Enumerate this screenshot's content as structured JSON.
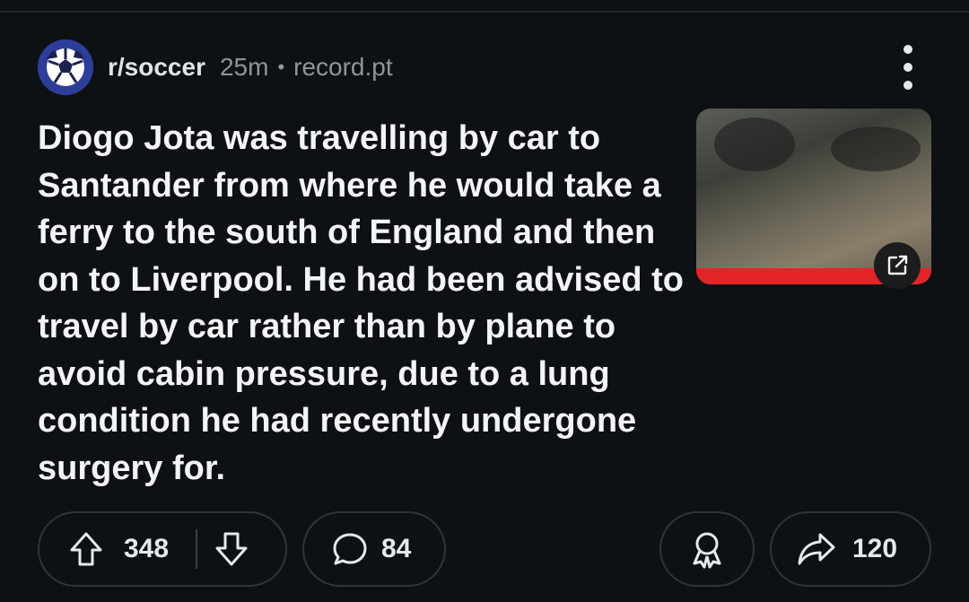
{
  "post": {
    "subreddit": "r/soccer",
    "age": "25m",
    "separator": "•",
    "domain": "record.pt",
    "title": "Diogo Jota was travelling by car to Santander from where he would take a ferry to the south of England and then on to Liverpool. He had been advised to travel by car rather than by plane to avoid cabin pressure, due to a lung condition he had recently undergone surgery for.",
    "thumbnail_icon": "external-link-icon"
  },
  "actions": {
    "upvotes": "348",
    "comments": "84",
    "shares": "120"
  },
  "icons": {
    "subreddit_avatar": "soccer-ball-icon",
    "more": "more-vertical-icon",
    "upvote": "upvote-arrow-icon",
    "downvote": "downvote-arrow-icon",
    "comment": "comment-bubble-icon",
    "award": "award-icon",
    "share": "share-arrow-icon"
  },
  "colors": {
    "background": "#0e1113",
    "text": "#f2f4f5",
    "muted": "#8c969c",
    "avatar": "#2c3e9a",
    "thumbnail_bar": "#e52428"
  }
}
